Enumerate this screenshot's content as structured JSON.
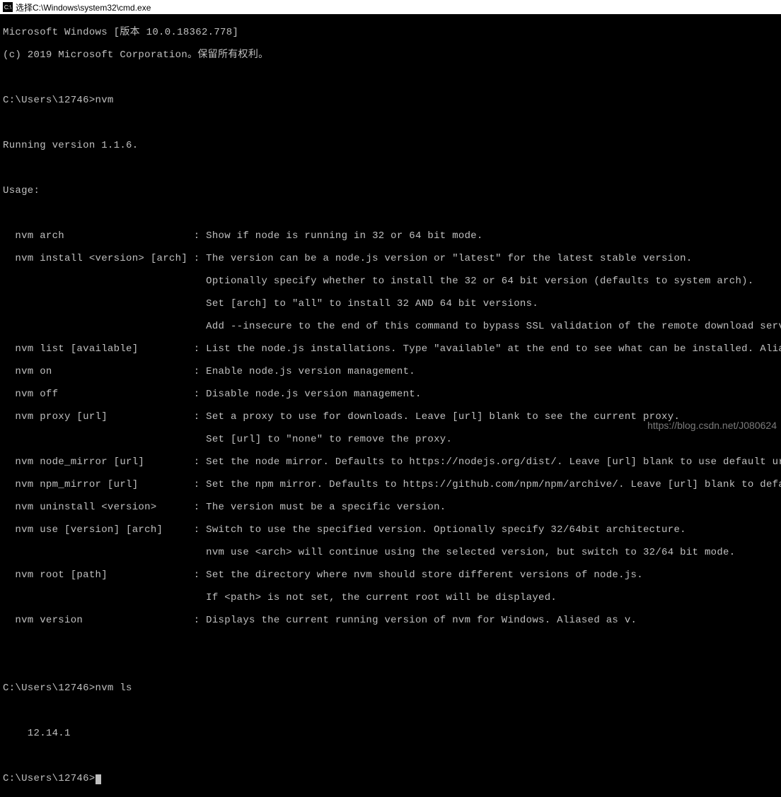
{
  "titlebar": {
    "icon_text": "C:\\",
    "title": "选择C:\\Windows\\system32\\cmd.exe"
  },
  "header": {
    "line1": "Microsoft Windows [版本 10.0.18362.778]",
    "line2": "(c) 2019 Microsoft Corporation。保留所有权利。"
  },
  "prompt1": {
    "path": "C:\\Users\\12746>",
    "command": "nvm"
  },
  "running_version": "Running version 1.1.6.",
  "usage_label": "Usage:",
  "usage": {
    "lines": [
      "  nvm arch                     : Show if node is running in 32 or 64 bit mode.",
      "  nvm install <version> [arch] : The version can be a node.js version or \"latest\" for the latest stable version.",
      "                                 Optionally specify whether to install the 32 or 64 bit version (defaults to system arch).",
      "                                 Set [arch] to \"all\" to install 32 AND 64 bit versions.",
      "                                 Add --insecure to the end of this command to bypass SSL validation of the remote download server.",
      "  nvm list [available]         : List the node.js installations. Type \"available\" at the end to see what can be installed. Aliased as ls.",
      "  nvm on                       : Enable node.js version management.",
      "  nvm off                      : Disable node.js version management.",
      "  nvm proxy [url]              : Set a proxy to use for downloads. Leave [url] blank to see the current proxy.",
      "                                 Set [url] to \"none\" to remove the proxy.",
      "  nvm node_mirror [url]        : Set the node mirror. Defaults to https://nodejs.org/dist/. Leave [url] blank to use default url.",
      "  nvm npm_mirror [url]         : Set the npm mirror. Defaults to https://github.com/npm/npm/archive/. Leave [url] blank to default url.",
      "  nvm uninstall <version>      : The version must be a specific version.",
      "  nvm use [version] [arch]     : Switch to use the specified version. Optionally specify 32/64bit architecture.",
      "                                 nvm use <arch> will continue using the selected version, but switch to 32/64 bit mode.",
      "  nvm root [path]              : Set the directory where nvm should store different versions of node.js.",
      "                                 If <path> is not set, the current root will be displayed.",
      "  nvm version                  : Displays the current running version of nvm for Windows. Aliased as v."
    ]
  },
  "prompt2": {
    "path": "C:\\Users\\12746>",
    "command": "nvm ls"
  },
  "ls_output": "    12.14.1",
  "prompt3": {
    "path": "C:\\Users\\12746>"
  },
  "watermark": "https://blog.csdn.net/J080624"
}
